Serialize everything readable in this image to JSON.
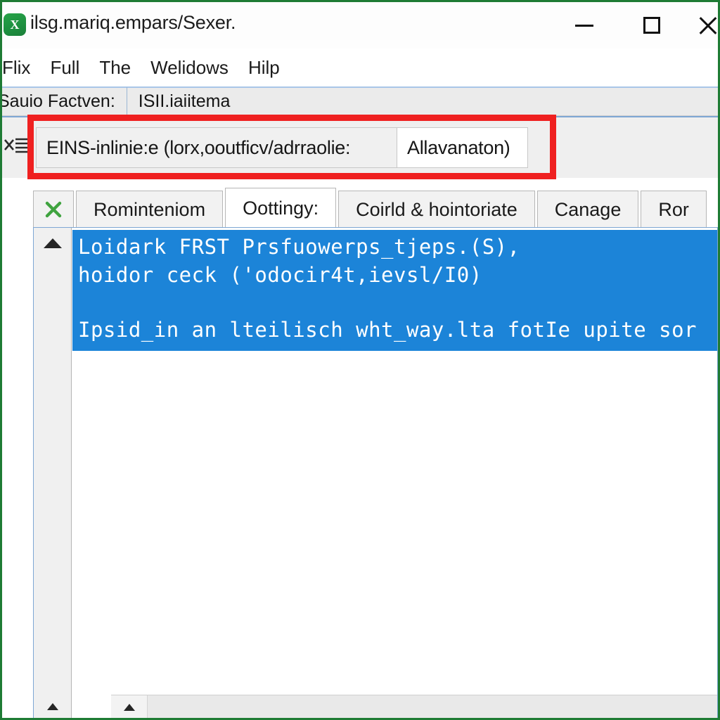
{
  "window": {
    "title": "ilsg.mariq.empars/Sexer.",
    "app_icon": "excel-green-x-icon",
    "frame_color": "#1e7b34",
    "controls": {
      "minimize_label": "minimize-icon",
      "maximize_label": "maximize-icon",
      "close_label": "close-icon"
    }
  },
  "menubar": {
    "items": [
      {
        "label": "Flix"
      },
      {
        "label": "Full"
      },
      {
        "label": "The"
      },
      {
        "label": "Welidows"
      },
      {
        "label": "Hilp"
      }
    ]
  },
  "infostrip": {
    "label": "Sauio Factven:",
    "value": "ISII.iaiitema"
  },
  "pathbar": {
    "left_icon": "list-clear-icon",
    "text": "EINS-inlinie:e (lorx,ooutficv/adrraolie:",
    "input_value": "Allavanaton)",
    "highlight_color": "#ef2020"
  },
  "tabs": {
    "icon_cell": "green-x-icon",
    "items": [
      {
        "label": "Rominteniom",
        "active": false
      },
      {
        "label": "Oottingy:",
        "active": true
      },
      {
        "label": "Coirld & hointoriate",
        "active": false
      },
      {
        "label": "Canage",
        "active": false
      },
      {
        "label": "Ror",
        "active": false
      }
    ]
  },
  "content": {
    "selection_color": "#1c84d8",
    "scroll": {
      "up_arrow": "scroll-up-arrow-icon",
      "down_arrow": "scroll-down-arrow-icon",
      "h_left_arrow": "scroll-left-arrow-icon"
    },
    "lines": [
      "Loidark FRST Prsfuowerps_tjeps.(S),",
      "hoidor ceck ('odocir4t,ievsl/I0)",
      "Ipsid_in an lteilisch wht_way.lta fotIe upite sor"
    ]
  }
}
